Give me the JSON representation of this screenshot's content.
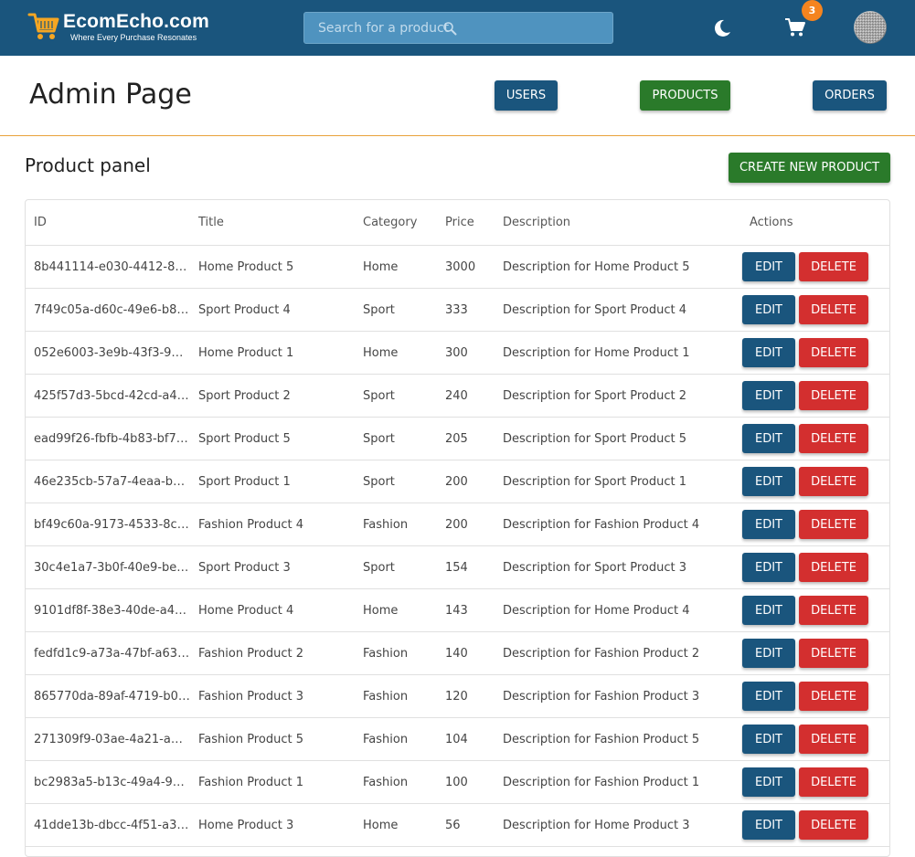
{
  "header": {
    "brand": "EcomEcho.com",
    "tagline": "Where Every Purchase Resonates",
    "search_placeholder": "Search for a product",
    "cart_count": "3",
    "colors": {
      "topbar": "#1a557d",
      "badge": "#f5841f"
    }
  },
  "admin": {
    "title": "Admin Page",
    "nav": {
      "users": "USERS",
      "products": "PRODUCTS",
      "orders": "ORDERS"
    }
  },
  "panel": {
    "title": "Product panel",
    "create_label": "CREATE NEW PRODUCT"
  },
  "table": {
    "headers": [
      "ID",
      "Title",
      "Category",
      "Price",
      "Description",
      "Actions"
    ],
    "edit_label": "EDIT",
    "delete_label": "DELETE",
    "rows": [
      {
        "id": "8b441114-e030-4412-895…",
        "title": "Home Product 5",
        "category": "Home",
        "price": "3000",
        "description": "Description for Home Product 5"
      },
      {
        "id": "7f49c05a-d60c-49e6-b8…",
        "title": "Sport Product 4",
        "category": "Sport",
        "price": "333",
        "description": "Description for Sport Product 4"
      },
      {
        "id": "052e6003-3e9b-43f3-9d…",
        "title": "Home Product 1",
        "category": "Home",
        "price": "300",
        "description": "Description for Home Product 1"
      },
      {
        "id": "425f57d3-5bcd-42cd-a4…",
        "title": "Sport Product 2",
        "category": "Sport",
        "price": "240",
        "description": "Description for Sport Product 2"
      },
      {
        "id": "ead99f26-fbfb-4b83-bf7…",
        "title": "Sport Product 5",
        "category": "Sport",
        "price": "205",
        "description": "Description for Sport Product 5"
      },
      {
        "id": "46e235cb-57a7-4eaa-b8c…",
        "title": "Sport Product 1",
        "category": "Sport",
        "price": "200",
        "description": "Description for Sport Product 1"
      },
      {
        "id": "bf49c60a-9173-4533-8ca…",
        "title": "Fashion Product 4",
        "category": "Fashion",
        "price": "200",
        "description": "Description for Fashion Product 4"
      },
      {
        "id": "30c4e1a7-3b0f-40e9-be6…",
        "title": "Sport Product 3",
        "category": "Sport",
        "price": "154",
        "description": "Description for Sport Product 3"
      },
      {
        "id": "9101df8f-38e3-40de-a46…",
        "title": "Home Product 4",
        "category": "Home",
        "price": "143",
        "description": "Description for Home Product 4"
      },
      {
        "id": "fedfd1c9-a73a-47bf-a635…",
        "title": "Fashion Product 2",
        "category": "Fashion",
        "price": "140",
        "description": "Description for Fashion Product 2"
      },
      {
        "id": "865770da-89af-4719-b00…",
        "title": "Fashion Product 3",
        "category": "Fashion",
        "price": "120",
        "description": "Description for Fashion Product 3"
      },
      {
        "id": "271309f9-03ae-4a21-a98…",
        "title": "Fashion Product 5",
        "category": "Fashion",
        "price": "104",
        "description": "Description for Fashion Product 5"
      },
      {
        "id": "bc2983a5-b13c-49a4-9a6…",
        "title": "Fashion Product 1",
        "category": "Fashion",
        "price": "100",
        "description": "Description for Fashion Product 1"
      },
      {
        "id": "41dde13b-dbcc-4f51-a31c…",
        "title": "Home Product 3",
        "category": "Home",
        "price": "56",
        "description": "Description for Home Product 3"
      }
    ]
  },
  "icons": [
    "cart-logo-icon",
    "search-icon",
    "moon-icon",
    "cart-icon",
    "avatar"
  ]
}
